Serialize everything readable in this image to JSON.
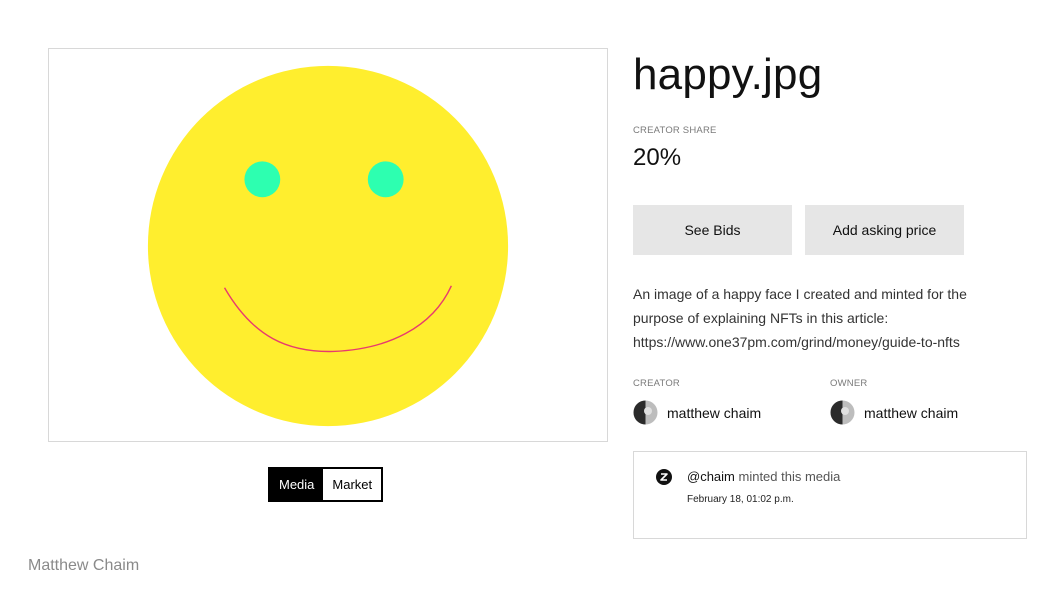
{
  "media": {
    "face_color": "#FFEE2E",
    "eye_color": "#2DFFB0",
    "mouth_color": "#E83A6E"
  },
  "view_toggle": {
    "options": [
      {
        "label": "Media",
        "active": true
      },
      {
        "label": "Market",
        "active": false
      }
    ]
  },
  "watermark": "Matthew Chaim",
  "title": "happy.jpg",
  "creator_share": {
    "label": "CREATOR SHARE",
    "value": "20%"
  },
  "actions": {
    "see_bids": "See Bids",
    "add_asking_price": "Add asking price"
  },
  "description": {
    "lines": [
      "An image of a happy face I created and minted for the",
      "purpose of explaining NFTs in this article:",
      "https://www.one37pm.com/grind/money/guide-to-nfts"
    ]
  },
  "creator": {
    "label": "CREATOR",
    "name": "matthew chaim"
  },
  "owner": {
    "label": "OWNER",
    "name": "matthew chaim"
  },
  "history": {
    "icon": "zora-icon",
    "handle": "@chaim",
    "action": "minted this media",
    "date": "February 18, 01:02 p.m."
  }
}
